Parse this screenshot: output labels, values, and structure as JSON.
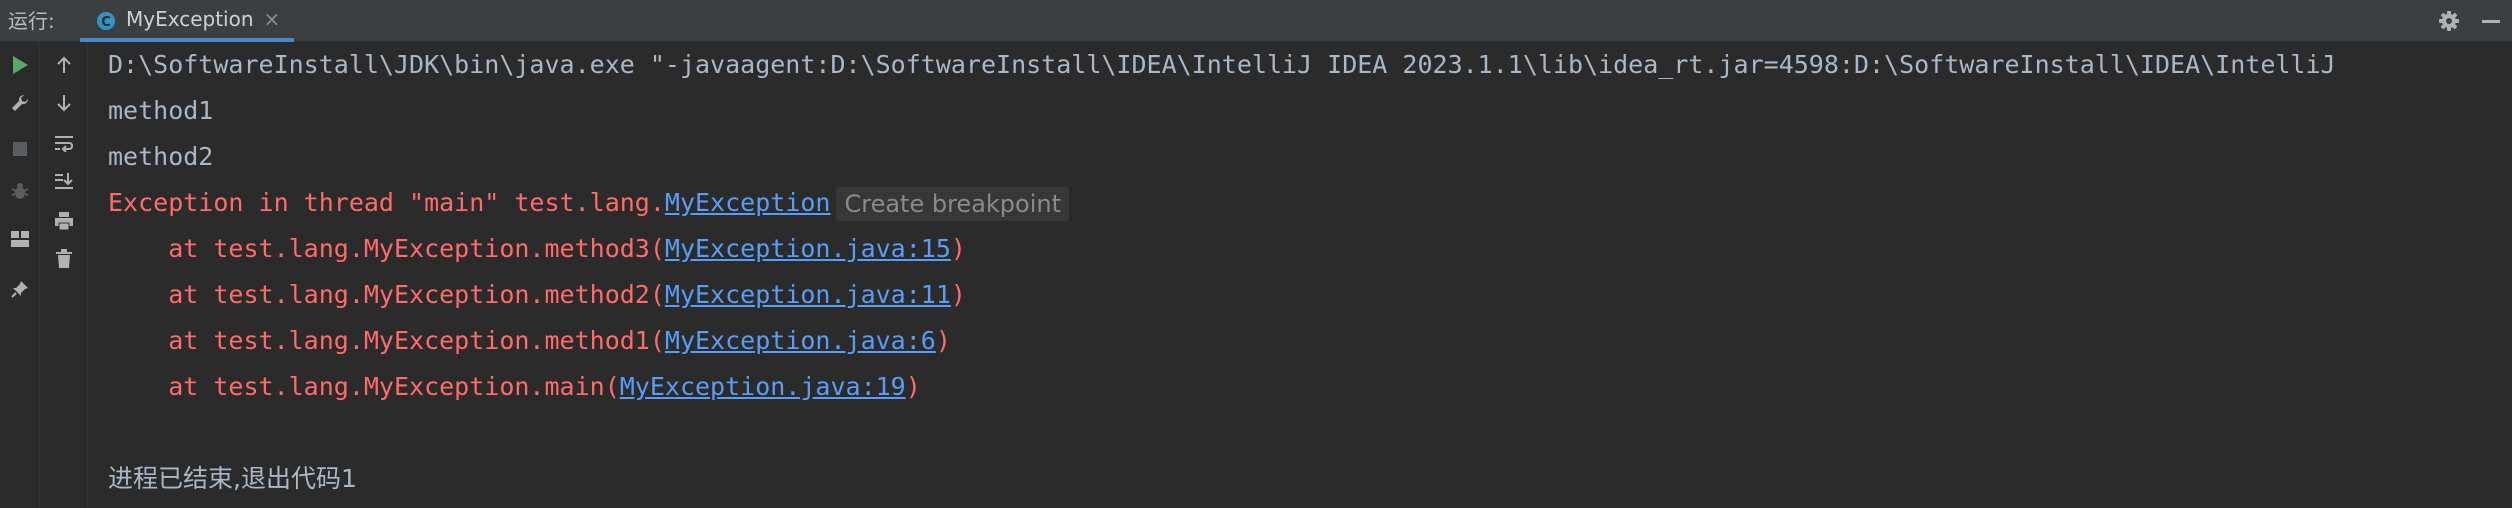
{
  "header": {
    "run_label": "运行:",
    "tab_label": "MyException",
    "tab_close": "×"
  },
  "colors": {
    "accent": "#4a88c7",
    "error_text": "#ff6b68",
    "link_text": "#589df6",
    "plain_text": "#a9b7c6",
    "run_green": "#59a869"
  },
  "console": {
    "command_line": "D:\\SoftwareInstall\\JDK\\bin\\java.exe \"-javaagent:D:\\SoftwareInstall\\IDEA\\IntelliJ IDEA 2023.1.1\\lib\\idea_rt.jar=4598:D:\\SoftwareInstall\\IDEA\\IntelliJ",
    "out1": "method1",
    "out2": "method2",
    "exception_prefix": "Exception in thread \"main\" test.lang.",
    "exception_class": "MyException",
    "breakpoint_hint": "Create breakpoint",
    "stack": [
      {
        "prefix": "    at test.lang.MyException.method3(",
        "link": "MyException.java:15",
        "suffix": ")"
      },
      {
        "prefix": "    at test.lang.MyException.method2(",
        "link": "MyException.java:11",
        "suffix": ")"
      },
      {
        "prefix": "    at test.lang.MyException.method1(",
        "link": "MyException.java:6",
        "suffix": ")"
      },
      {
        "prefix": "    at test.lang.MyException.main(",
        "link": "MyException.java:19",
        "suffix": ")"
      }
    ],
    "exit_message": "进程已结束,退出代码1"
  },
  "icons": {
    "tab": "java-class-icon",
    "settings": "gear-icon",
    "hide": "minimize-icon",
    "left_toolbar": [
      "run-icon",
      "wrench-icon",
      "stop-icon",
      "debug-icon",
      "layout-icon",
      "pin-icon"
    ],
    "console_toolbar": [
      "arrow-up-icon",
      "arrow-down-icon",
      "soft-wrap-icon",
      "scroll-to-end-icon",
      "print-icon",
      "trash-icon"
    ]
  }
}
